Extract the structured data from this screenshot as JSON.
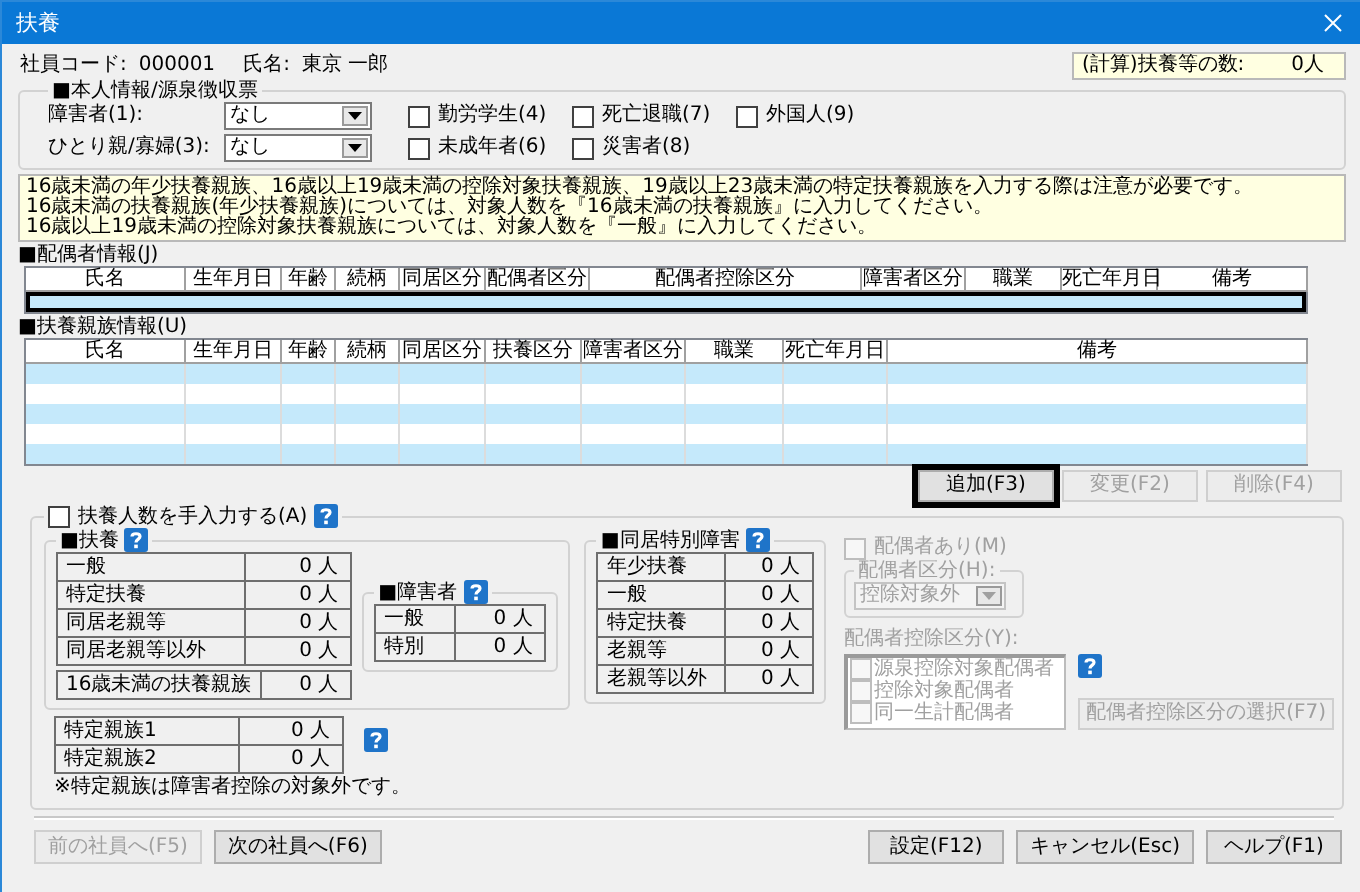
{
  "window": {
    "title": "扶養"
  },
  "employee": {
    "code_label": "社員コード:",
    "code": "000001",
    "name_label": "氏名:",
    "name": "東京 一郎"
  },
  "dependent_total": {
    "label": "(計算)扶養等の数:",
    "value": "0人"
  },
  "self_info": {
    "title": "■本人情報/源泉徴収票",
    "selects": [
      {
        "label": "障害者(1):",
        "value": "なし"
      },
      {
        "label": "ひとり親/寡婦(3):",
        "value": "なし"
      }
    ],
    "checkboxes": [
      {
        "label": "勤労学生(4)",
        "checked": false
      },
      {
        "label": "死亡退職(7)",
        "checked": false
      },
      {
        "label": "外国人(9)",
        "checked": false
      },
      {
        "label": "未成年者(6)",
        "checked": false
      },
      {
        "label": "災害者(8)",
        "checked": false
      }
    ]
  },
  "notice": [
    "16歳未満の年少扶養親族、16歳以上19歳未満の控除対象扶養親族、19歳以上23歳未満の特定扶養親族を入力する際は注意が必要です。",
    "16歳未満の扶養親族(年少扶養親族)については、対象人数を『16歳未満の扶養親族』に入力してください。",
    "16歳以上19歳未満の控除対象扶養親族については、対象人数を『一般』に入力してください。"
  ],
  "spouse_table": {
    "title": "■配偶者情報(J)",
    "columns": [
      "氏名",
      "生年月日",
      "年齢",
      "続柄",
      "同居区分",
      "配偶者区分",
      "配偶者控除区分",
      "障害者区分",
      "職業",
      "死亡年月日",
      "備考"
    ],
    "rows": [
      {
        "selected": true
      }
    ]
  },
  "dependents_table": {
    "title": "■扶養親族情報(U)",
    "columns": [
      "氏名",
      "生年月日",
      "年齢",
      "続柄",
      "同居区分",
      "扶養区分",
      "障害者区分",
      "職業",
      "死亡年月日",
      "備考"
    ],
    "rows": [
      {
        "selected": false
      },
      {
        "selected": false
      },
      {
        "selected": false
      },
      {
        "selected": false
      },
      {
        "selected": false
      }
    ]
  },
  "row_buttons": [
    {
      "label": "追加(F3)",
      "disabled": false,
      "highlighted": true
    },
    {
      "label": "変更(F2)",
      "disabled": true,
      "highlighted": false
    },
    {
      "label": "削除(F4)",
      "disabled": true,
      "highlighted": false
    }
  ],
  "manual_entry": {
    "label": "扶養人数を手入力する(A)",
    "checked": false
  },
  "dependents": {
    "title": "■扶養",
    "rows": [
      {
        "label": "一般",
        "value": "0 人"
      },
      {
        "label": "特定扶養",
        "value": "0 人"
      },
      {
        "label": "同居老親等",
        "value": "0 人"
      },
      {
        "label": "同居老親等以外",
        "value": "0 人"
      }
    ],
    "extra_rows": [
      {
        "label": "16歳未満の扶養親族",
        "value": "0 人"
      }
    ]
  },
  "disabled_persons": {
    "title": "■障害者",
    "rows": [
      {
        "label": "一般",
        "value": "0 人"
      },
      {
        "label": "特別",
        "value": "0 人"
      }
    ]
  },
  "specific_relatives": {
    "rows": [
      {
        "label": "特定親族1",
        "value": "0 人"
      },
      {
        "label": "特定親族2",
        "value": "0 人"
      }
    ],
    "note": "※特定親族は障害者控除の対象外です。"
  },
  "cohabiting_special_disabled": {
    "title": "■同居特別障害",
    "rows": [
      {
        "label": "年少扶養",
        "value": "0 人"
      },
      {
        "label": "一般",
        "value": "0 人"
      },
      {
        "label": "特定扶養",
        "value": "0 人"
      },
      {
        "label": "老親等",
        "value": "0 人"
      },
      {
        "label": "老親等以外",
        "value": "0 人"
      }
    ]
  },
  "spouse": {
    "disabled": true,
    "has_spouse": {
      "label": "配偶者あり(M)",
      "checked": false
    },
    "category": {
      "title": "配偶者区分(H):",
      "value": "控除対象外"
    },
    "deduction": {
      "label": "配偶者控除区分(Y):",
      "options": [
        {
          "label": "源泉控除対象配偶者",
          "checked": false
        },
        {
          "label": "控除対象配偶者",
          "checked": false
        },
        {
          "label": "同一生計配偶者",
          "checked": false
        }
      ]
    },
    "select_button": {
      "label": "配偶者控除区分の選択(F7)"
    }
  },
  "footer_buttons": [
    {
      "label": "前の社員へ(F5)",
      "kind": "nav",
      "disabled": true
    },
    {
      "label": "次の社員へ(F6)",
      "kind": "nav",
      "disabled": false
    },
    {
      "label": "設定(F12)",
      "kind": "action",
      "disabled": false
    },
    {
      "label": "キャンセル(Esc)",
      "kind": "action",
      "disabled": false
    },
    {
      "label": "ヘルプ(F1)",
      "kind": "action",
      "disabled": false
    }
  ]
}
